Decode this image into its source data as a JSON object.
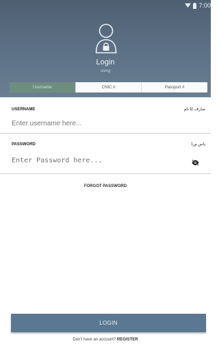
{
  "status_bar": {
    "time": "7:00"
  },
  "header": {
    "title": "Login",
    "subtitle": "using",
    "tabs": [
      {
        "label": "Username",
        "active": true
      },
      {
        "label": "CNIC #",
        "active": false
      },
      {
        "label": "Passport #",
        "active": false
      }
    ]
  },
  "form": {
    "username": {
      "label": "USERNAME",
      "label_urdu": "صارف کا نام",
      "placeholder": "Enter username here...",
      "value": ""
    },
    "password": {
      "label": "PASSWORD",
      "label_urdu": "پاس ورڈ",
      "placeholder": "Enter Password here...",
      "value": "",
      "toggle_icon": "eye-off-icon"
    },
    "forgot_password": "FORGOT PASSWORD"
  },
  "footer": {
    "login_button": "LOGIN",
    "register_prompt": "Don't have an account?",
    "register_link": "REGISTER"
  },
  "colors": {
    "header_top": "#4e5f72",
    "header_bottom": "#6b7f93",
    "active_tab": "#6d8e7c",
    "login_button": "#5a7891"
  }
}
